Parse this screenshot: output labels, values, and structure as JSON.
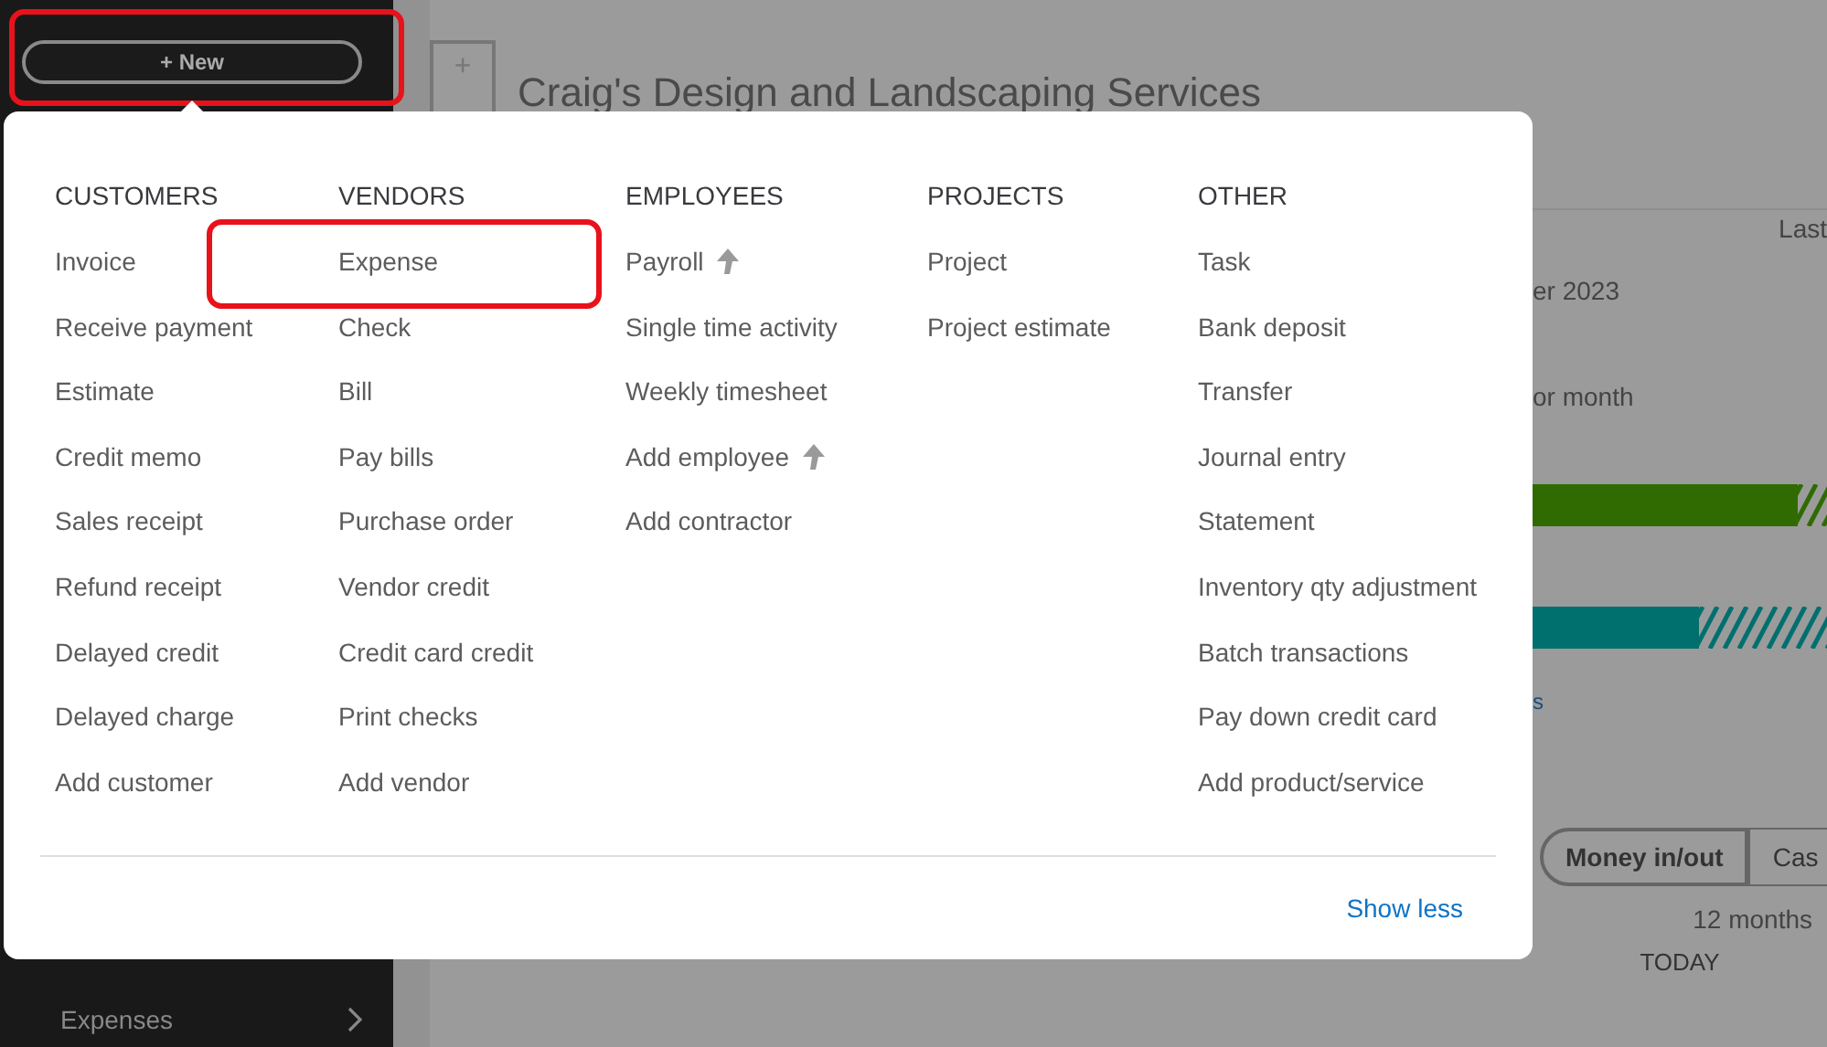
{
  "sidebar": {
    "new_button": "+ New",
    "items": [
      {
        "label": "Expenses"
      }
    ]
  },
  "header": {
    "logo": "+",
    "title": "Craig's Design and Landscaping Services"
  },
  "background": {
    "period": "Last",
    "month": "er 2023",
    "month_note": "or month",
    "link": "s",
    "toggle": [
      {
        "label": "Money in/out",
        "selected": true
      },
      {
        "label": "Cas",
        "selected": false
      }
    ],
    "range": "12 months",
    "today": "TODAY"
  },
  "menu": {
    "columns": [
      {
        "title": "CUSTOMERS",
        "items": [
          {
            "label": "Invoice"
          },
          {
            "label": "Receive payment"
          },
          {
            "label": "Estimate"
          },
          {
            "label": "Credit memo"
          },
          {
            "label": "Sales receipt"
          },
          {
            "label": "Refund receipt"
          },
          {
            "label": "Delayed credit"
          },
          {
            "label": "Delayed charge"
          },
          {
            "label": "Add customer"
          }
        ]
      },
      {
        "title": "VENDORS",
        "items": [
          {
            "label": "Expense"
          },
          {
            "label": "Check"
          },
          {
            "label": "Bill"
          },
          {
            "label": "Pay bills"
          },
          {
            "label": "Purchase order"
          },
          {
            "label": "Vendor credit"
          },
          {
            "label": "Credit card credit"
          },
          {
            "label": "Print checks"
          },
          {
            "label": "Add vendor"
          }
        ]
      },
      {
        "title": "EMPLOYEES",
        "items": [
          {
            "label": "Payroll",
            "upgrade": true
          },
          {
            "label": "Single time activity",
            "upgrade": false
          },
          {
            "label": "Weekly timesheet",
            "upgrade": false
          },
          {
            "label": "Add employee",
            "upgrade": true
          },
          {
            "label": "Add contractor",
            "upgrade": false
          }
        ]
      },
      {
        "title": "PROJECTS",
        "items": [
          {
            "label": "Project"
          },
          {
            "label": "Project estimate"
          }
        ]
      },
      {
        "title": "OTHER",
        "items": [
          {
            "label": "Task"
          },
          {
            "label": "Bank deposit"
          },
          {
            "label": "Transfer"
          },
          {
            "label": "Journal entry"
          },
          {
            "label": "Statement"
          },
          {
            "label": "Inventory qty adjustment"
          },
          {
            "label": "Batch transactions"
          },
          {
            "label": "Pay down credit card"
          },
          {
            "label": "Add product/service"
          }
        ]
      }
    ],
    "show_less": "Show less"
  }
}
